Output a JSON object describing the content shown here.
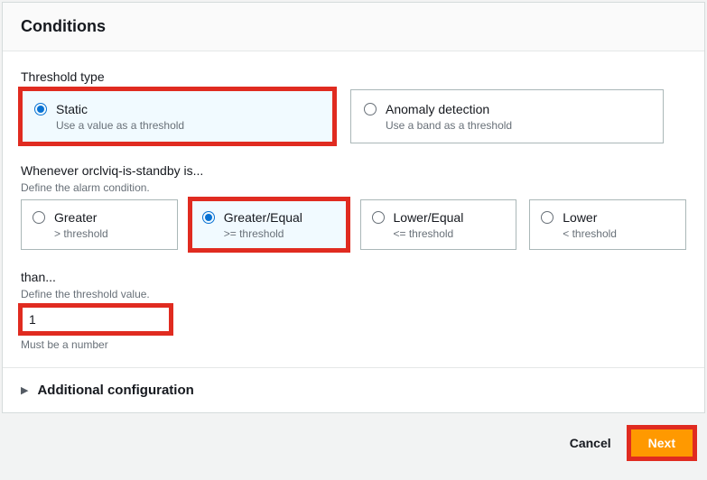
{
  "panel": {
    "title": "Conditions"
  },
  "thresholdType": {
    "label": "Threshold type",
    "options": [
      {
        "title": "Static",
        "sub": "Use a value as a threshold"
      },
      {
        "title": "Anomaly detection",
        "sub": "Use a band as a threshold"
      }
    ]
  },
  "condition": {
    "label": "Whenever orclviq-is-standby is...",
    "desc": "Define the alarm condition.",
    "options": [
      {
        "title": "Greater",
        "sub": "> threshold"
      },
      {
        "title": "Greater/Equal",
        "sub": ">= threshold"
      },
      {
        "title": "Lower/Equal",
        "sub": "<= threshold"
      },
      {
        "title": "Lower",
        "sub": "< threshold"
      }
    ]
  },
  "thresholdValue": {
    "label": "than...",
    "desc": "Define the threshold value.",
    "value": "1",
    "constraint": "Must be a number"
  },
  "expander": {
    "title": "Additional configuration"
  },
  "footer": {
    "cancel": "Cancel",
    "next": "Next"
  }
}
